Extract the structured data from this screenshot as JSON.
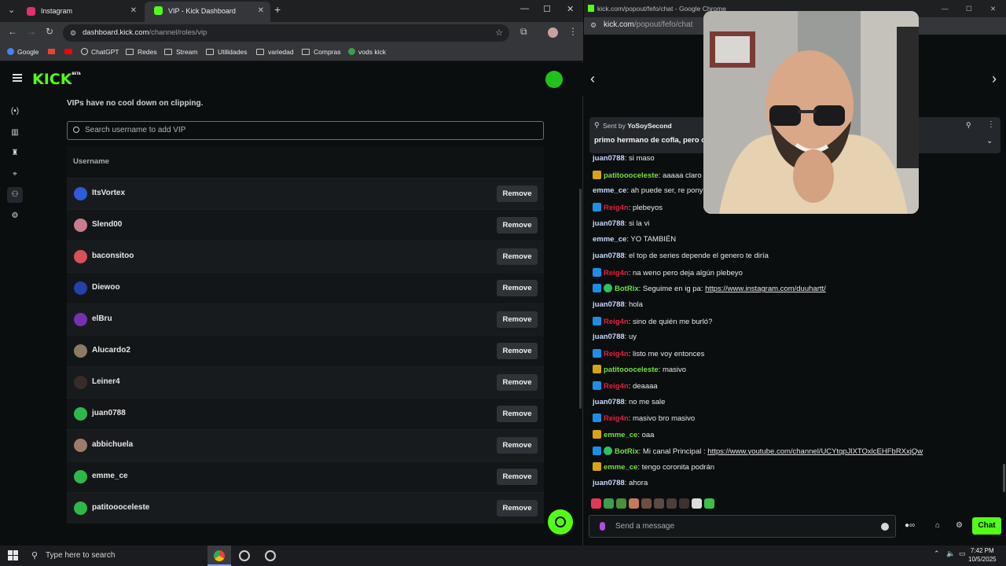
{
  "left_window": {
    "tabs": [
      {
        "label": "Instagram",
        "favicon_color": "#e1306c"
      },
      {
        "label": "VIP - Kick Dashboard",
        "favicon_color": "#53fc18"
      }
    ],
    "address": {
      "host": "dashboard.kick.com",
      "path": "/channel/roles/vip"
    },
    "bookmarks": [
      "Google",
      "ChatGPT",
      "Redes",
      "Stream",
      "Utilidades",
      "variedad",
      "Compras",
      "vods kick"
    ],
    "kick_logo": "KICK",
    "kick_beta": "BETA",
    "sidebar_icons": [
      "broadcast-icon",
      "analytics-icon",
      "trophy-icon",
      "moderation-icon",
      "roles-icon",
      "settings-icon"
    ],
    "vip_note": "VIPs have no cool down on clipping.",
    "search_placeholder": "Search username to add VIP",
    "table_header": "Username",
    "remove_label": "Remove",
    "vips": [
      {
        "name": "ItsVortex",
        "color": "#2d5bd9"
      },
      {
        "name": "Slend00",
        "color": "#c97b8f"
      },
      {
        "name": "baconsitoo",
        "color": "#d8505a"
      },
      {
        "name": "Diewoo",
        "color": "#2142a8"
      },
      {
        "name": "elBru",
        "color": "#7a2fb0"
      },
      {
        "name": "Alucardo2",
        "color": "#8a7b62"
      },
      {
        "name": "Leiner4",
        "color": "#3a2a2a"
      },
      {
        "name": "juan0788",
        "color": "#2fb84a"
      },
      {
        "name": "abbichuela",
        "color": "#a07a6a"
      },
      {
        "name": "emme_ce",
        "color": "#2fb84a"
      },
      {
        "name": "patitoooceleste",
        "color": "#2fb84a"
      }
    ]
  },
  "right_window": {
    "title": "kick.com/popout/fefo/chat - Google Chrome",
    "address": {
      "host": "kick.com",
      "path": "/popout/fefo/chat"
    },
    "pinned": {
      "sent_by_label": "Sent by",
      "sender": "YoSoySecond",
      "text": "primo hermano de cofla, pero c"
    },
    "messages": [
      {
        "user": "juan0788",
        "color": "#c8d8ff",
        "badges": [],
        "text": ": si maso"
      },
      {
        "user": "patitoooceleste",
        "color": "#72e046",
        "badges": [
          "crown"
        ],
        "text": ": aaaaa claro"
      },
      {
        "user": "emme_ce",
        "color": "#c8d8ff",
        "badges": [],
        "text": ": ah puede ser, re pony a"
      },
      {
        "user": "Reig4n",
        "color": "#e0213f",
        "badges": [
          "arrow"
        ],
        "text": ": plebeyos"
      },
      {
        "user": "juan0788",
        "color": "#c8d8ff",
        "badges": [],
        "text": ": si la vi"
      },
      {
        "user": "emme_ce",
        "color": "#c8d8ff",
        "badges": [],
        "text": ": YO TAMBIÉN"
      },
      {
        "user": "juan0788",
        "color": "#c8d8ff",
        "badges": [],
        "text": ": el top de series depende el genero te diría"
      },
      {
        "user": "Reig4n",
        "color": "#e0213f",
        "badges": [
          "arrow"
        ],
        "text": ": na weno pero deja algún plebeyo"
      },
      {
        "user": "BotRix",
        "color": "#72e046",
        "badges": [
          "arrow",
          "verified"
        ],
        "text": ": Seguime en ig pa: ",
        "link": "https://www.instagram.com/duuhartt/"
      },
      {
        "user": "juan0788",
        "color": "#c8d8ff",
        "badges": [],
        "text": ": hola"
      },
      {
        "user": "Reig4n",
        "color": "#e0213f",
        "badges": [
          "arrow"
        ],
        "text": ": sino de quién me burló?"
      },
      {
        "user": "juan0788",
        "color": "#c8d8ff",
        "badges": [],
        "text": ": uy"
      },
      {
        "user": "Reig4n",
        "color": "#e0213f",
        "badges": [
          "arrow"
        ],
        "text": ": listo me voy entonces"
      },
      {
        "user": "patitoooceleste",
        "color": "#72e046",
        "badges": [
          "crown"
        ],
        "text": ": masivo"
      },
      {
        "user": "Reig4n",
        "color": "#e0213f",
        "badges": [
          "arrow"
        ],
        "text": ": deaaaa"
      },
      {
        "user": "juan0788",
        "color": "#c8d8ff",
        "badges": [],
        "text": ": no me sale"
      },
      {
        "user": "Reig4n",
        "color": "#e0213f",
        "badges": [
          "arrow"
        ],
        "text": ": masivo bro masivo"
      },
      {
        "user": "emme_ce",
        "color": "#72e046",
        "badges": [
          "crown"
        ],
        "text": ": oaa"
      },
      {
        "user": "BotRix",
        "color": "#72e046",
        "badges": [
          "arrow",
          "verified"
        ],
        "text": ": Mi canal Principal : ",
        "link": "https://www.youtube.com/channel/UCYtqpJlXTOxlcEHFbRXxjQw"
      },
      {
        "user": "emme_ce",
        "color": "#72e046",
        "badges": [
          "crown"
        ],
        "text": ": tengo coronita podrán"
      },
      {
        "user": "juan0788",
        "color": "#c8d8ff",
        "badges": [],
        "text": ": ahora"
      }
    ],
    "emote_colors": [
      "#e8355a",
      "#3b9e4a",
      "#4a8f3a",
      "#c47a55",
      "#6d5040",
      "#5a4a44",
      "#4d3e3a",
      "#3e3230",
      "#ddd",
      "#3cc04a"
    ],
    "input_placeholder": "Send a message",
    "chat_button": "Chat"
  },
  "taskbar": {
    "search_placeholder": "Type here to search",
    "time": "7:42 PM",
    "date": "10/5/2025"
  }
}
